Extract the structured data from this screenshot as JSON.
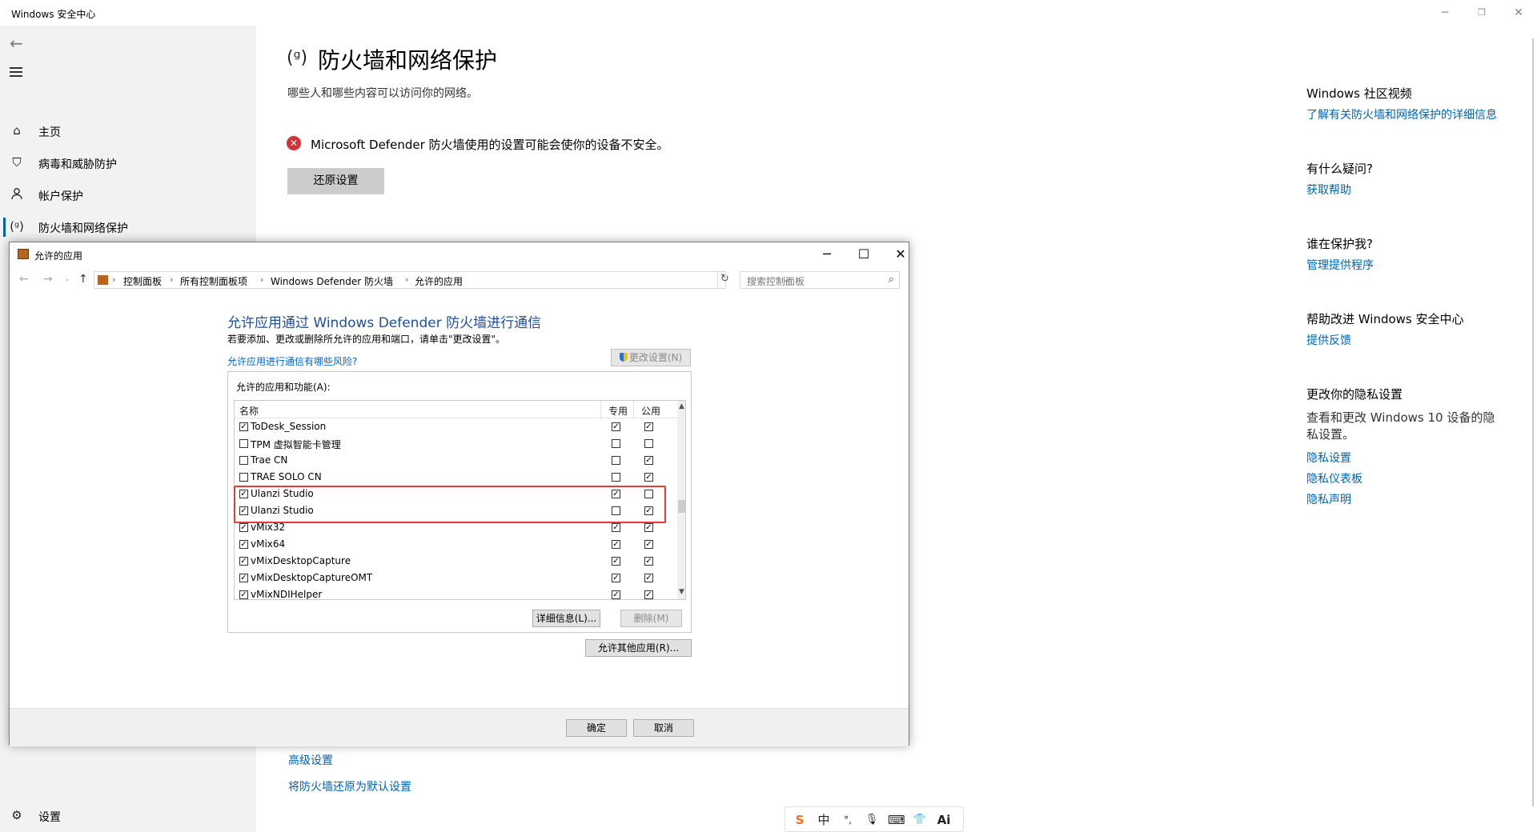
{
  "window": {
    "title": "Windows 安全中心"
  },
  "sidebar": {
    "items": [
      {
        "label": "主页",
        "icon": "home-icon"
      },
      {
        "label": "病毒和威胁防护",
        "icon": "shield-icon"
      },
      {
        "label": "帐户保护",
        "icon": "person-icon"
      },
      {
        "label": "防火墙和网络保护",
        "icon": "antenna-icon"
      }
    ],
    "settings_label": "设置"
  },
  "main": {
    "title": "防火墙和网络保护",
    "subtitle": "哪些人和哪些内容可以访问你的网络。",
    "warning": "Microsoft Defender 防火墙使用的设置可能会使你的设备不安全。",
    "restore_button": "还原设置",
    "links": [
      "高级设置",
      "将防火墙还原为默认设置"
    ]
  },
  "right_panel": {
    "community_heading": "Windows 社区视频",
    "community_link": "了解有关防火墙和网络保护的详细信息",
    "question_heading": "有什么疑问?",
    "question_link": "获取帮助",
    "protect_heading": "谁在保护我?",
    "protect_link": "管理提供程序",
    "improve_heading": "帮助改进 Windows 安全中心",
    "improve_link": "提供反馈",
    "privacy_heading": "更改你的隐私设置",
    "privacy_text": "查看和更改 Windows 10 设备的隐私设置。",
    "privacy_links": [
      "隐私设置",
      "隐私仪表板",
      "隐私声明"
    ]
  },
  "dialog": {
    "title": "允许的应用",
    "breadcrumbs": [
      "控制面板",
      "所有控制面板项",
      "Windows Defender 防火墙",
      "允许的应用"
    ],
    "search_placeholder": "搜索控制面板",
    "heading": "允许应用通过 Windows Defender 防火墙进行通信",
    "description": "若要添加、更改或删除所允许的应用和端口，请单击\"更改设置\"。",
    "risk_link": "允许应用进行通信有哪些风险?",
    "change_settings_button": "更改设置(N)",
    "group_label": "允许的应用和功能(A):",
    "columns": {
      "name": "名称",
      "private": "专用",
      "public": "公用"
    },
    "rows": [
      {
        "name": "ToDesk_Session",
        "enabled": true,
        "private": true,
        "public": true
      },
      {
        "name": "TPM 虚拟智能卡管理",
        "enabled": false,
        "private": false,
        "public": false
      },
      {
        "name": "Trae CN",
        "enabled": false,
        "private": false,
        "public": true
      },
      {
        "name": "TRAE SOLO CN",
        "enabled": false,
        "private": false,
        "public": true
      },
      {
        "name": "Ulanzi Studio",
        "enabled": true,
        "private": true,
        "public": false
      },
      {
        "name": "Ulanzi Studio",
        "enabled": true,
        "private": false,
        "public": true
      },
      {
        "name": "vMix32",
        "enabled": true,
        "private": true,
        "public": true
      },
      {
        "name": "vMix64",
        "enabled": true,
        "private": true,
        "public": true
      },
      {
        "name": "vMixDesktopCapture",
        "enabled": true,
        "private": true,
        "public": true
      },
      {
        "name": "vMixDesktopCaptureOMT",
        "enabled": true,
        "private": true,
        "public": true
      },
      {
        "name": "vMixNDIHelper",
        "enabled": true,
        "private": true,
        "public": true
      }
    ],
    "details_button": "详细信息(L)...",
    "remove_button": "删除(M)",
    "allow_other_button": "允许其他应用(R)...",
    "ok_button": "确定",
    "cancel_button": "取消"
  },
  "ime": {
    "items": [
      {
        "glyph": "S",
        "icon": "sogou-logo-icon"
      },
      {
        "glyph": "中",
        "icon": "chinese-mode-icon"
      },
      {
        "glyph": "°,",
        "icon": "punctuation-icon"
      },
      {
        "glyph": "🎙",
        "icon": "microphone-icon"
      },
      {
        "glyph": "⌨",
        "icon": "keyboard-icon"
      },
      {
        "glyph": "👕",
        "icon": "skin-icon"
      },
      {
        "glyph": "Ai",
        "icon": "ai-assistant-icon"
      }
    ]
  },
  "colors": {
    "accent": "#0063b1",
    "error": "#d13438",
    "highlight": "#e53935"
  }
}
